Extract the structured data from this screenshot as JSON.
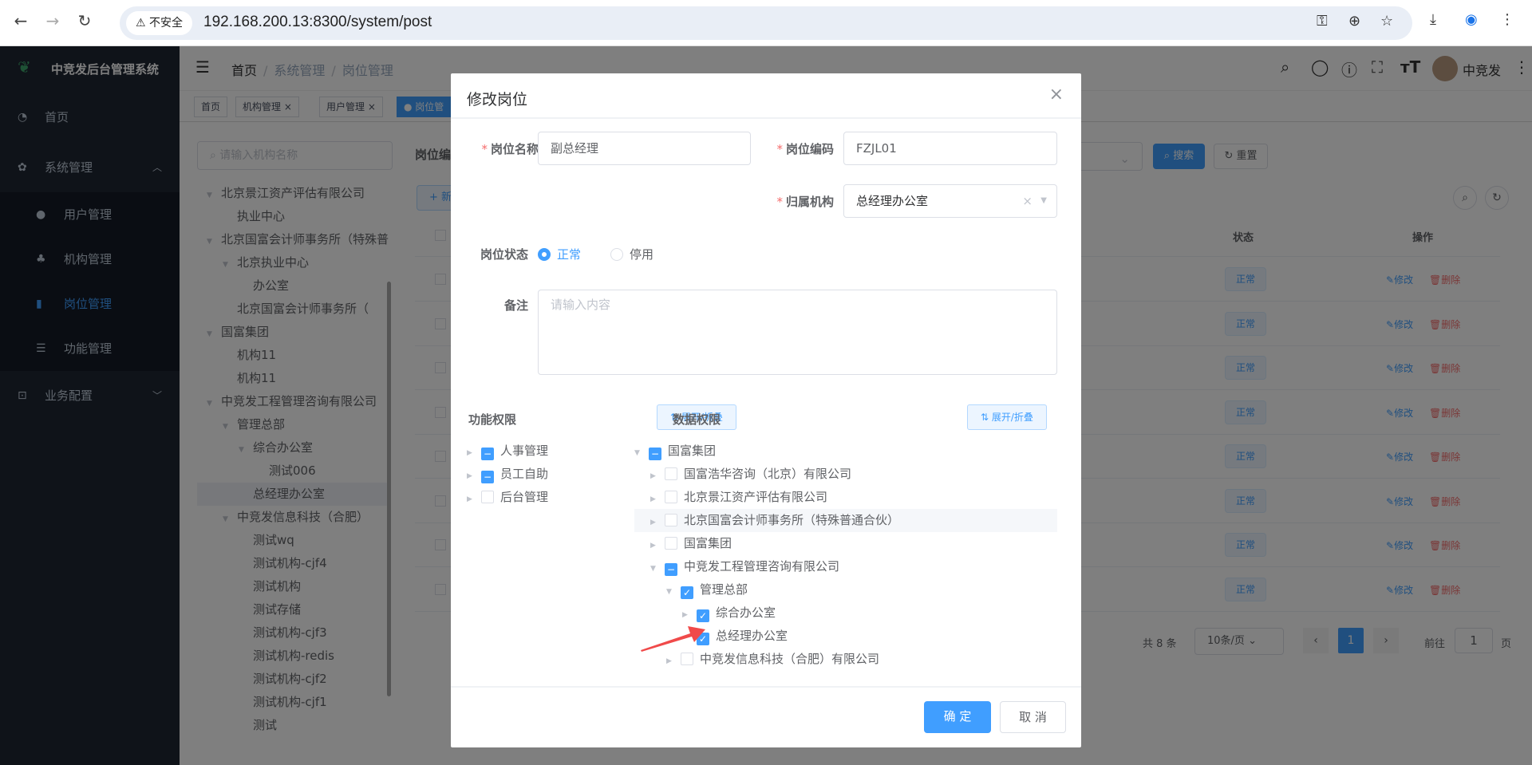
{
  "browser": {
    "insecure_label": "不安全",
    "url": "192.168.200.13:8300/system/post"
  },
  "app": {
    "title": "中竞发后台管理系统",
    "user": "中竞发"
  },
  "sidebar": {
    "items": [
      {
        "label": "首页"
      },
      {
        "label": "系统管理"
      },
      {
        "label": "用户管理"
      },
      {
        "label": "机构管理"
      },
      {
        "label": "岗位管理"
      },
      {
        "label": "功能管理"
      },
      {
        "label": "业务配置"
      }
    ]
  },
  "breadcrumb": [
    "首页",
    "系统管理",
    "岗位管理"
  ],
  "tags": [
    "首页",
    "机构管理",
    "用户管理",
    "岗位管"
  ],
  "org_tree": {
    "search_placeholder": "请输入机构名称",
    "nodes": [
      {
        "label": "北京景江资产评估有限公司",
        "level": 0,
        "caret": true
      },
      {
        "label": "执业中心",
        "level": 1,
        "caret": false
      },
      {
        "label": "北京国富会计师事务所（特殊普通合伙）",
        "level": 0,
        "caret": true
      },
      {
        "label": "北京执业中心",
        "level": 1,
        "caret": true
      },
      {
        "label": "办公室",
        "level": 2,
        "caret": false
      },
      {
        "label": "北京国富会计师事务所（",
        "level": 1,
        "caret": false
      },
      {
        "label": "国富集团",
        "level": 0,
        "caret": true
      },
      {
        "label": "机构11",
        "level": 1,
        "caret": false
      },
      {
        "label": "机构11",
        "level": 1,
        "caret": false
      },
      {
        "label": "中竞发工程管理咨询有限公司",
        "level": 0,
        "caret": true
      },
      {
        "label": "管理总部",
        "level": 1,
        "caret": true
      },
      {
        "label": "综合办公室",
        "level": 2,
        "caret": true
      },
      {
        "label": "测试006",
        "level": 3,
        "caret": false
      },
      {
        "label": "总经理办公室",
        "level": 2,
        "caret": false,
        "selected": true
      },
      {
        "label": "中竞发信息科技（合肥）",
        "level": 1,
        "caret": true
      },
      {
        "label": "测试wq",
        "level": 2,
        "caret": false
      },
      {
        "label": "测试机构-cjf4",
        "level": 2,
        "caret": false
      },
      {
        "label": "测试机构",
        "level": 2,
        "caret": false
      },
      {
        "label": "测试存储",
        "level": 2,
        "caret": false
      },
      {
        "label": "测试机构-cjf3",
        "level": 2,
        "caret": false
      },
      {
        "label": "测试机构-redis",
        "level": 2,
        "caret": false
      },
      {
        "label": "测试机构-cjf2",
        "level": 2,
        "caret": false
      },
      {
        "label": "测试机构-cjf1",
        "level": 2,
        "caret": false
      },
      {
        "label": "测试",
        "level": 2,
        "caret": false
      }
    ]
  },
  "main": {
    "filter_label": "岗位编",
    "search_button": "搜索",
    "reset_button": "重置",
    "add_button": "新",
    "col_status": "状态",
    "col_ops": "操作",
    "rows": [
      {
        "status": "正常",
        "edit": "修改",
        "delete": "删除"
      },
      {
        "status": "正常",
        "edit": "修改",
        "delete": "删除"
      },
      {
        "status": "正常",
        "edit": "修改",
        "delete": "删除"
      },
      {
        "status": "正常",
        "edit": "修改",
        "delete": "删除"
      },
      {
        "status": "正常",
        "edit": "修改",
        "delete": "删除"
      },
      {
        "status": "正常",
        "edit": "修改",
        "delete": "删除"
      },
      {
        "status": "正常",
        "edit": "修改",
        "delete": "删除"
      },
      {
        "status": "正常",
        "edit": "修改",
        "delete": "删除"
      }
    ],
    "pagination": {
      "total": "共 8 条",
      "page_size": "10条/页",
      "current": "1",
      "goto_label": "前往",
      "goto_value": "1",
      "page_suffix": "页"
    }
  },
  "dialog": {
    "title": "修改岗位",
    "post_name_label": "岗位名称",
    "post_name": "副总经理",
    "post_code_label": "岗位编码",
    "post_code": "FZJL01",
    "org_label": "归属机构",
    "org_value": "总经理办公室",
    "status_label": "岗位状态",
    "status_normal": "正常",
    "status_disabled": "停用",
    "remark_label": "备注",
    "remark_placeholder": "请输入内容",
    "func_perm_label": "功能权限",
    "data_perm_label": "数据权限",
    "expand_label": "展开/折叠",
    "confirm": "确 定",
    "cancel": "取 消",
    "func_tree": [
      {
        "label": "人事管理",
        "state": "ind",
        "level": 0,
        "caret": "right"
      },
      {
        "label": "员工自助",
        "state": "ind",
        "level": 0,
        "caret": "right"
      },
      {
        "label": "后台管理",
        "state": "none",
        "level": 0,
        "caret": "right"
      }
    ],
    "data_tree": [
      {
        "label": "国富集团",
        "state": "ind",
        "level": 0,
        "caret": "down"
      },
      {
        "label": "国富浩华咨询（北京）有限公司",
        "state": "none",
        "level": 1,
        "caret": "right"
      },
      {
        "label": "北京景江资产评估有限公司",
        "state": "none",
        "level": 1,
        "caret": "right"
      },
      {
        "label": "北京国富会计师事务所（特殊普通合伙）",
        "state": "none",
        "level": 1,
        "caret": "right",
        "hover": true
      },
      {
        "label": "国富集团",
        "state": "none",
        "level": 1,
        "caret": "right"
      },
      {
        "label": "中竞发工程管理咨询有限公司",
        "state": "ind",
        "level": 1,
        "caret": "down"
      },
      {
        "label": "管理总部",
        "state": "chk",
        "level": 2,
        "caret": "down"
      },
      {
        "label": "综合办公室",
        "state": "chk",
        "level": 3,
        "caret": "right"
      },
      {
        "label": "总经理办公室",
        "state": "chk",
        "level": 3,
        "caret": ""
      },
      {
        "label": "中竞发信息科技（合肥）有限公司",
        "state": "none",
        "level": 2,
        "caret": "right"
      }
    ]
  },
  "colors": {
    "primary": "#409eff",
    "danger": "#f56c6c",
    "sidebar": "#1f2633",
    "annotation_arrow": "#f04a4a"
  }
}
